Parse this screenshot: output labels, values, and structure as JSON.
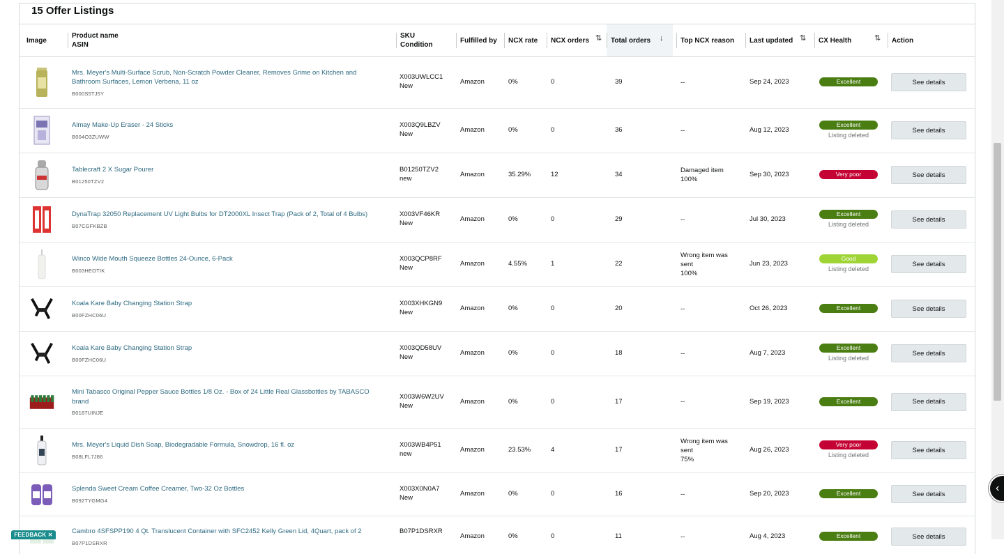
{
  "title": "15 Offer Listings",
  "columns": {
    "image": "Image",
    "product_name": "Product name",
    "asin": "ASIN",
    "sku": "SKU",
    "condition": "Condition",
    "fulfilled_by": "Fulfilled by",
    "ncx_rate": "NCX rate",
    "ncx_orders": "NCX orders",
    "total_orders": "Total orders",
    "top_ncx_reason": "Top NCX reason",
    "last_updated": "Last updated",
    "cx_health": "CX Health",
    "action": "Action"
  },
  "rows": [
    {
      "name": "Mrs. Meyer's Multi-Surface Scrub, Non-Scratch Powder Cleaner, Removes Grime on Kitchen and Bathroom Surfaces, Lemon Verbena, 11 oz",
      "asin": "B000S5TJ5Y",
      "sku": "X003UWLCC1",
      "condition": "New",
      "fulfilled": "Amazon",
      "ncx_rate": "0%",
      "ncx_orders": "0",
      "total": "39",
      "reason": "--",
      "updated": "Sep 24, 2023",
      "health": "Excellent",
      "health_class": "excellent",
      "listing_note": "",
      "action": "See details",
      "thumb": "canister-icon"
    },
    {
      "name": "Almay Make-Up Eraser - 24 Sticks",
      "asin": "B004O3ZUWW",
      "sku": "X003Q9LBZV",
      "condition": "New",
      "fulfilled": "Amazon",
      "ncx_rate": "0%",
      "ncx_orders": "0",
      "total": "36",
      "reason": "--",
      "updated": "Aug 12, 2023",
      "health": "Excellent",
      "health_class": "excellent",
      "listing_note": "Listing deleted",
      "action": "See details",
      "thumb": "box-icon"
    },
    {
      "name": "Tablecraft 2 X Sugar Pourer",
      "asin": "B01250TZV2",
      "sku": "B01250TZV2",
      "condition": "new",
      "fulfilled": "Amazon",
      "ncx_rate": "35.29%",
      "ncx_orders": "12",
      "total": "34",
      "reason": "Damaged item\n100%",
      "updated": "Sep 30, 2023",
      "health": "Very poor",
      "health_class": "verypoor",
      "listing_note": "",
      "action": "See details",
      "thumb": "jar-icon"
    },
    {
      "name": "DynaTrap 32050 Replacement UV Light Bulbs for DT2000XL Insect Trap (Pack of 2, Total of 4 Bulbs)",
      "asin": "B07CGFKBZB",
      "sku": "X003VF46KR",
      "condition": "New",
      "fulfilled": "Amazon",
      "ncx_rate": "0%",
      "ncx_orders": "0",
      "total": "29",
      "reason": "--",
      "updated": "Jul 30, 2023",
      "health": "Excellent",
      "health_class": "excellent",
      "listing_note": "Listing deleted",
      "action": "See details",
      "thumb": "bulbs-icon"
    },
    {
      "name": "Winco Wide Mouth Squeeze Bottles 24-Ounce, 6-Pack",
      "asin": "B003HEOTIK",
      "sku": "X003QCP8RF",
      "condition": "New",
      "fulfilled": "Amazon",
      "ncx_rate": "4.55%",
      "ncx_orders": "1",
      "total": "22",
      "reason": "Wrong item was sent\n100%",
      "updated": "Jun 23, 2023",
      "health": "Good",
      "health_class": "good",
      "listing_note": "Listing deleted",
      "action": "See details",
      "thumb": "bottle-icon"
    },
    {
      "name": "Koala Kare Baby Changing Station Strap",
      "asin": "B00FZHC06U",
      "sku": "X003XHKGN9",
      "condition": "New",
      "fulfilled": "Amazon",
      "ncx_rate": "0%",
      "ncx_orders": "0",
      "total": "20",
      "reason": "--",
      "updated": "Oct 26, 2023",
      "health": "Excellent",
      "health_class": "excellent",
      "listing_note": "",
      "action": "See details",
      "thumb": "strap-icon"
    },
    {
      "name": "Koala Kare Baby Changing Station Strap",
      "asin": "B00FZHC06U",
      "sku": "X003QD58UV",
      "condition": "New",
      "fulfilled": "Amazon",
      "ncx_rate": "0%",
      "ncx_orders": "0",
      "total": "18",
      "reason": "--",
      "updated": "Aug 7, 2023",
      "health": "Excellent",
      "health_class": "excellent",
      "listing_note": "Listing deleted",
      "action": "See details",
      "thumb": "strap-icon"
    },
    {
      "name": "Mini Tabasco Original Pepper Sauce Bottles 1/8 Oz. - Box of 24 Little Real Glassbottles by TABASCO brand",
      "asin": "B0187UINJE",
      "sku": "X003W6W2UV",
      "condition": "New",
      "fulfilled": "Amazon",
      "ncx_rate": "0%",
      "ncx_orders": "0",
      "total": "17",
      "reason": "--",
      "updated": "Sep 19, 2023",
      "health": "Excellent",
      "health_class": "excellent",
      "listing_note": "",
      "action": "See details",
      "thumb": "tabasco-icon"
    },
    {
      "name": "Mrs. Meyer's Liquid Dish Soap, Biodegradable Formula, Snowdrop, 16 fl. oz",
      "asin": "B08LFL7J86",
      "sku": "X003WB4P51",
      "condition": "new",
      "fulfilled": "Amazon",
      "ncx_rate": "23.53%",
      "ncx_orders": "4",
      "total": "17",
      "reason": "Wrong item was sent\n75%",
      "updated": "Aug 26, 2023",
      "health": "Very poor",
      "health_class": "verypoor",
      "listing_note": "Listing deleted",
      "action": "See details",
      "thumb": "soap-icon"
    },
    {
      "name": "Splenda Sweet Cream Coffee Creamer, Two-32 Oz Bottles",
      "asin": "B092TYGMG4",
      "sku": "X003X0N0A7",
      "condition": "New",
      "fulfilled": "Amazon",
      "ncx_rate": "0%",
      "ncx_orders": "0",
      "total": "16",
      "reason": "--",
      "updated": "Sep 20, 2023",
      "health": "Excellent",
      "health_class": "excellent",
      "listing_note": "",
      "action": "See details",
      "thumb": "creamer-icon"
    },
    {
      "name": "Cambro 4SFSPP190 4 Qt. Translucent Container with SFC2452 Kelly Green Lid, 4Quart, pack of 2",
      "asin": "B07P1DSRXR",
      "sku": "B07P1DSRXR",
      "condition": "",
      "fulfilled": "Amazon",
      "ncx_rate": "0%",
      "ncx_orders": "0",
      "total": "11",
      "reason": "--",
      "updated": "Aug 4, 2023",
      "health": "Excellent",
      "health_class": "excellent",
      "listing_note": "",
      "action": "See details",
      "thumb": "container-icon"
    }
  ],
  "feedback": "FEEDBACK ✕",
  "side_button": "‹"
}
